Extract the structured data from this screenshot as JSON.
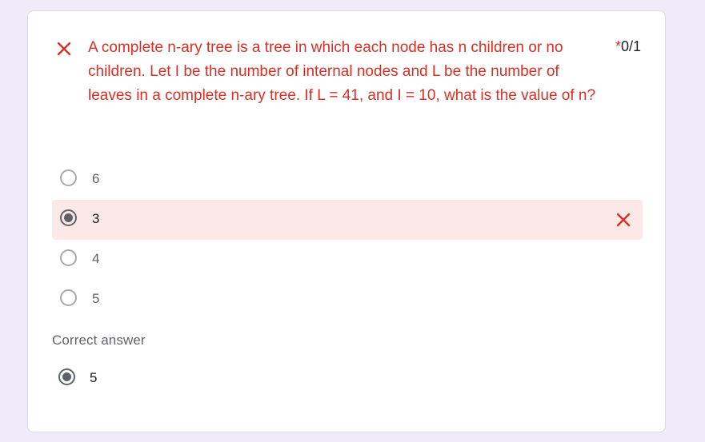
{
  "question": {
    "text": "A complete n-ary tree is a tree in which each node has n children or no children. Let I be the number of internal nodes and L be the number of leaves in a complete n-ary tree. If L = 41, and I = 10, what is the value of n?",
    "required_marker": "*",
    "score": "0/1",
    "status": "incorrect",
    "status_icon": "close-icon"
  },
  "options": [
    {
      "label": "6",
      "selected": false
    },
    {
      "label": "3",
      "selected": true,
      "marked_wrong": true
    },
    {
      "label": "4",
      "selected": false
    },
    {
      "label": "5",
      "selected": false
    }
  ],
  "correct_answer": {
    "title": "Correct answer",
    "label": "5"
  },
  "colors": {
    "error": "#d93025",
    "wrong_bg": "#fce8e6",
    "page_bg": "#f0ebf8"
  }
}
